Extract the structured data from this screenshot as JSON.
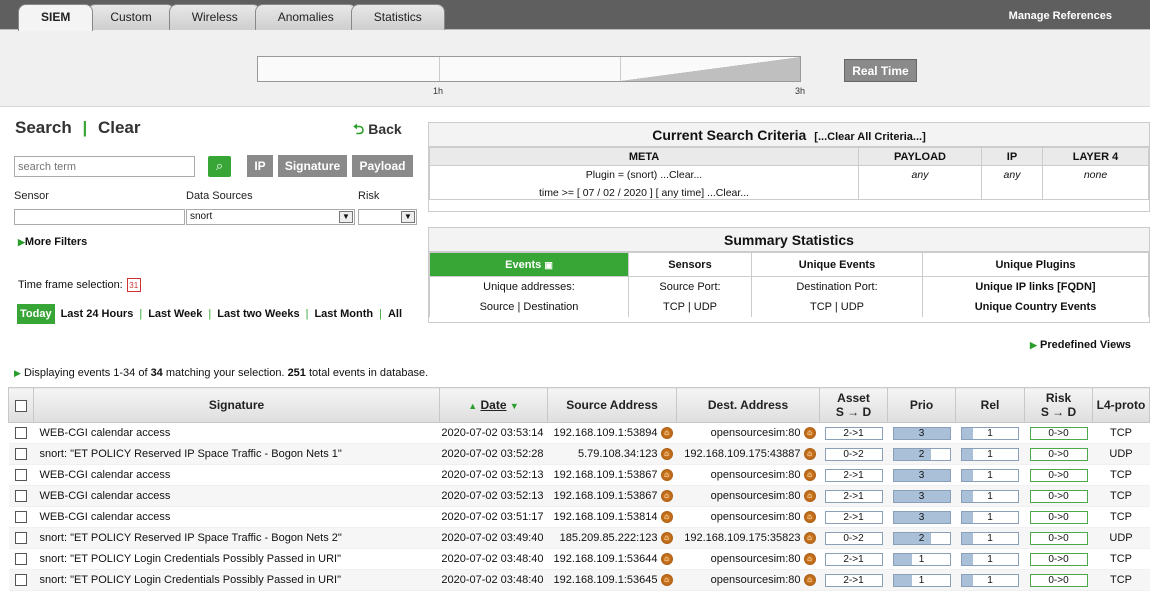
{
  "tabs": [
    "SIEM",
    "Custom",
    "Wireless",
    "Anomalies",
    "Statistics"
  ],
  "manage_refs": "Manage References",
  "timeline": {
    "label_1h": "1h",
    "label_3h": "3h"
  },
  "realtime": "Real Time",
  "search": {
    "title": "Search",
    "sep": "|",
    "clear": "Clear",
    "back": "Back",
    "placeholder": "search term",
    "go_icon": "search-icon",
    "ip": "IP",
    "signature": "Signature",
    "payload": "Payload",
    "sensor_label": "Sensor",
    "sources_label": "Data Sources",
    "sources_value": "snort",
    "risk_label": "Risk",
    "more_filters": "More Filters",
    "timeframe": "Time frame selection:",
    "time_links": [
      "Today",
      "Last 24 Hours",
      "Last Week",
      "Last two Weeks",
      "Last Month",
      "All"
    ]
  },
  "criteria": {
    "title": "Current Search Criteria",
    "clear_all": "[...Clear All Criteria...]",
    "cols": [
      "META",
      "PAYLOAD",
      "IP",
      "LAYER 4"
    ],
    "meta_line1": "Plugin = (snort)  ...Clear...",
    "meta_line2": "time >= [ 07 / 02 / 2020 ] [ any time]   ...Clear...",
    "payload": "any",
    "ip": "any",
    "layer4": "none"
  },
  "summary": {
    "title": "Summary Statistics",
    "cols": [
      "Events",
      "Sensors",
      "Unique Events",
      "Unique Plugins"
    ],
    "row1": [
      "Unique addresses:",
      "Source Port:",
      "Destination Port:",
      "Unique IP links [FQDN]"
    ],
    "row2": [
      "Source | Destination",
      "TCP | UDP",
      "TCP | UDP",
      "Unique Country Events"
    ]
  },
  "predefined": "Predefined Views",
  "display": {
    "pre": "Displaying events 1-34 of",
    "count": "34",
    "mid": "matching your selection.",
    "total": "251",
    "post": "total events in database."
  },
  "grid": {
    "cols": [
      "Signature",
      "Date",
      "Source Address",
      "Dest. Address",
      "Asset",
      "Prio",
      "Rel",
      "Risk",
      "L4-proto"
    ],
    "asset_sub": "S → D",
    "risk_sub": "S → D",
    "rows": [
      {
        "sig": "WEB-CGI calendar access",
        "date": "2020-07-02 03:53:14",
        "src": "192.168.109.1:53894",
        "dst": "opensourcesim:80",
        "asset": "2->1",
        "prio": "3",
        "prio_v": 1.0,
        "rel": "1",
        "rel_v": 0.2,
        "risk": "0->0",
        "proto": "TCP"
      },
      {
        "sig": "snort: \"ET POLICY Reserved IP Space Traffic - Bogon Nets 1\"",
        "date": "2020-07-02 03:52:28",
        "src": "5.79.108.34:123",
        "dst": "192.168.109.175:43887",
        "asset": "0->2",
        "prio": "2",
        "prio_v": 0.67,
        "rel": "1",
        "rel_v": 0.2,
        "risk": "0->0",
        "proto": "UDP"
      },
      {
        "sig": "WEB-CGI calendar access",
        "date": "2020-07-02 03:52:13",
        "src": "192.168.109.1:53867",
        "dst": "opensourcesim:80",
        "asset": "2->1",
        "prio": "3",
        "prio_v": 1.0,
        "rel": "1",
        "rel_v": 0.2,
        "risk": "0->0",
        "proto": "TCP"
      },
      {
        "sig": "WEB-CGI calendar access",
        "date": "2020-07-02 03:52:13",
        "src": "192.168.109.1:53867",
        "dst": "opensourcesim:80",
        "asset": "2->1",
        "prio": "3",
        "prio_v": 1.0,
        "rel": "1",
        "rel_v": 0.2,
        "risk": "0->0",
        "proto": "TCP"
      },
      {
        "sig": "WEB-CGI calendar access",
        "date": "2020-07-02 03:51:17",
        "src": "192.168.109.1:53814",
        "dst": "opensourcesim:80",
        "asset": "2->1",
        "prio": "3",
        "prio_v": 1.0,
        "rel": "1",
        "rel_v": 0.2,
        "risk": "0->0",
        "proto": "TCP"
      },
      {
        "sig": "snort: \"ET POLICY Reserved IP Space Traffic - Bogon Nets 2\"",
        "date": "2020-07-02 03:49:40",
        "src": "185.209.85.222:123",
        "dst": "192.168.109.175:35823",
        "asset": "0->2",
        "prio": "2",
        "prio_v": 0.67,
        "rel": "1",
        "rel_v": 0.2,
        "risk": "0->0",
        "proto": "UDP"
      },
      {
        "sig": "snort: \"ET POLICY Login Credentials Possibly Passed in URI\"",
        "date": "2020-07-02 03:48:40",
        "src": "192.168.109.1:53644",
        "dst": "opensourcesim:80",
        "asset": "2->1",
        "prio": "1",
        "prio_v": 0.33,
        "rel": "1",
        "rel_v": 0.2,
        "risk": "0->0",
        "proto": "TCP"
      },
      {
        "sig": "snort: \"ET POLICY Login Credentials Possibly Passed in URI\"",
        "date": "2020-07-02 03:48:40",
        "src": "192.168.109.1:53645",
        "dst": "opensourcesim:80",
        "asset": "2->1",
        "prio": "1",
        "prio_v": 0.33,
        "rel": "1",
        "rel_v": 0.2,
        "risk": "0->0",
        "proto": "TCP"
      }
    ]
  }
}
